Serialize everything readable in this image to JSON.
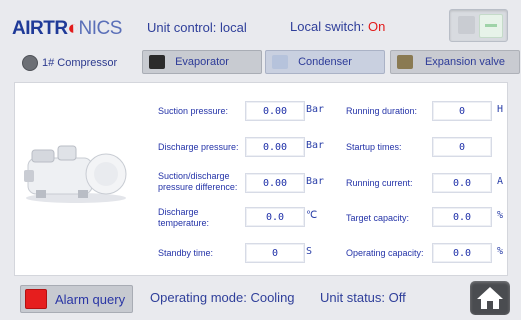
{
  "header": {
    "logo_part1": "AIR",
    "logo_part2": "TR",
    "logo_part3": "NICS",
    "unit_control": "Unit control: local",
    "local_switch_label": "Local switch:",
    "local_switch_value": "On"
  },
  "tabs": {
    "compressor": "1# Compressor",
    "evaporator": "Evaporator",
    "condenser": "Condenser",
    "expansion": "Expansion valve"
  },
  "params_left": [
    {
      "label": "Suction pressure:",
      "value": "0.00",
      "unit": "Bar"
    },
    {
      "label": "Discharge pressure:",
      "value": "0.00",
      "unit": "Bar"
    },
    {
      "label": "Suction/discharge pressure difference:",
      "value": "0.00",
      "unit": "Bar"
    },
    {
      "label": "Discharge temperature:",
      "value": "0.0",
      "unit": "℃"
    },
    {
      "label": "Standby time:",
      "value": "0",
      "unit": "S"
    }
  ],
  "params_right": [
    {
      "label": "Running duration:",
      "value": "0",
      "unit": "H"
    },
    {
      "label": "Startup times:",
      "value": "0",
      "unit": ""
    },
    {
      "label": "Running current:",
      "value": "0.0",
      "unit": "A"
    },
    {
      "label": "Target capacity:",
      "value": "0.0",
      "unit": "%"
    },
    {
      "label": "Operating capacity:",
      "value": "0.0",
      "unit": "%"
    }
  ],
  "footer": {
    "alarm_query": "Alarm query",
    "operating_mode": "Operating mode: Cooling",
    "unit_status": "Unit status: Off"
  },
  "colors": {
    "label_blue": "#2433a8",
    "on_red": "#e21b1b",
    "alarm_red": "#e61e1e"
  }
}
